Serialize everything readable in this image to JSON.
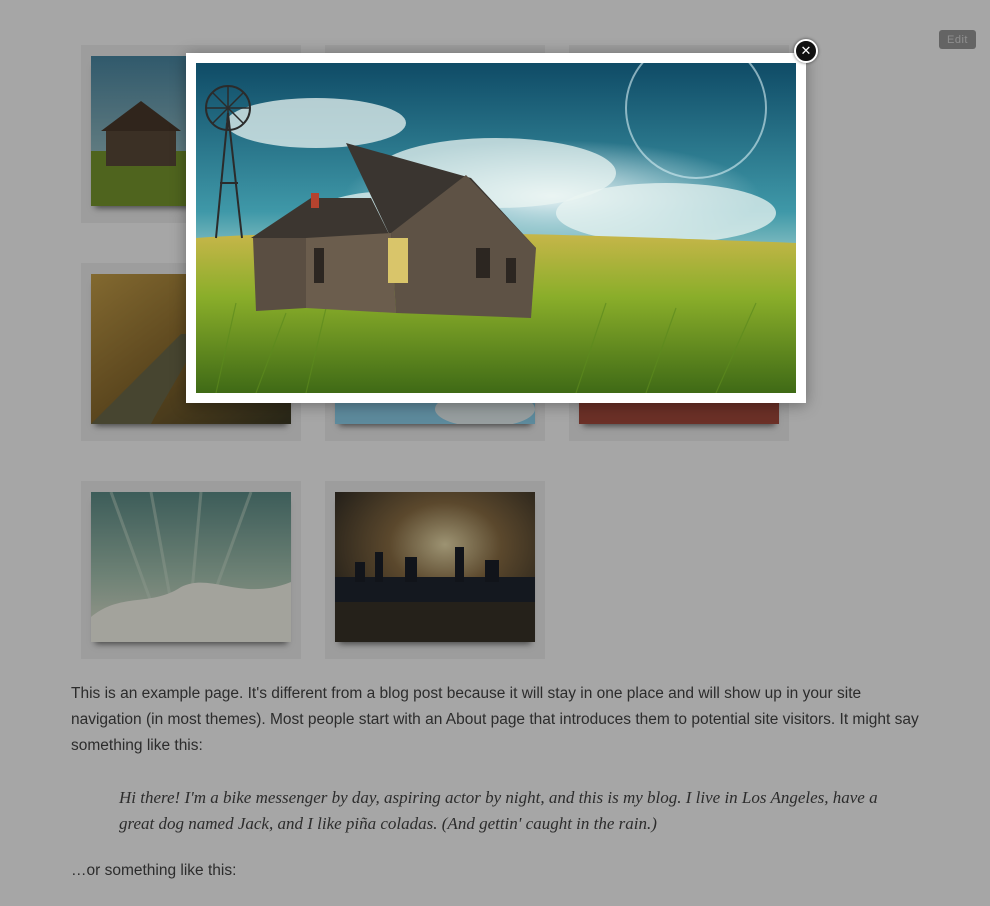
{
  "toolbar": {
    "edit_label": "Edit"
  },
  "gallery": {
    "items": [
      {
        "name": "farmhouse-field"
      },
      {
        "name": "forest-path"
      },
      {
        "name": "cloudy-sky"
      },
      {
        "name": "sunset-clouds"
      },
      {
        "name": "aurora-mountains"
      },
      {
        "name": "city-skyline-night"
      }
    ]
  },
  "content": {
    "intro": "This is an example page. It's different from a blog post because it will stay in one place and will show up in your site navigation (in most themes). Most people start with an About page that introduces them to potential site visitors. It might say something like this:",
    "quote": "Hi there! I'm a bike messenger by day, aspiring actor by night, and this is my blog. I live in Los Angeles, have a great dog named Jack, and I like piña coladas. (And gettin' caught in the rain.)",
    "outro": "…or something like this:"
  },
  "lightbox": {
    "close_icon": "close-icon",
    "image": "farmhouse-field"
  },
  "colors": {
    "overlay": "#000000",
    "text": "#444444",
    "frame": "#ffffff"
  }
}
